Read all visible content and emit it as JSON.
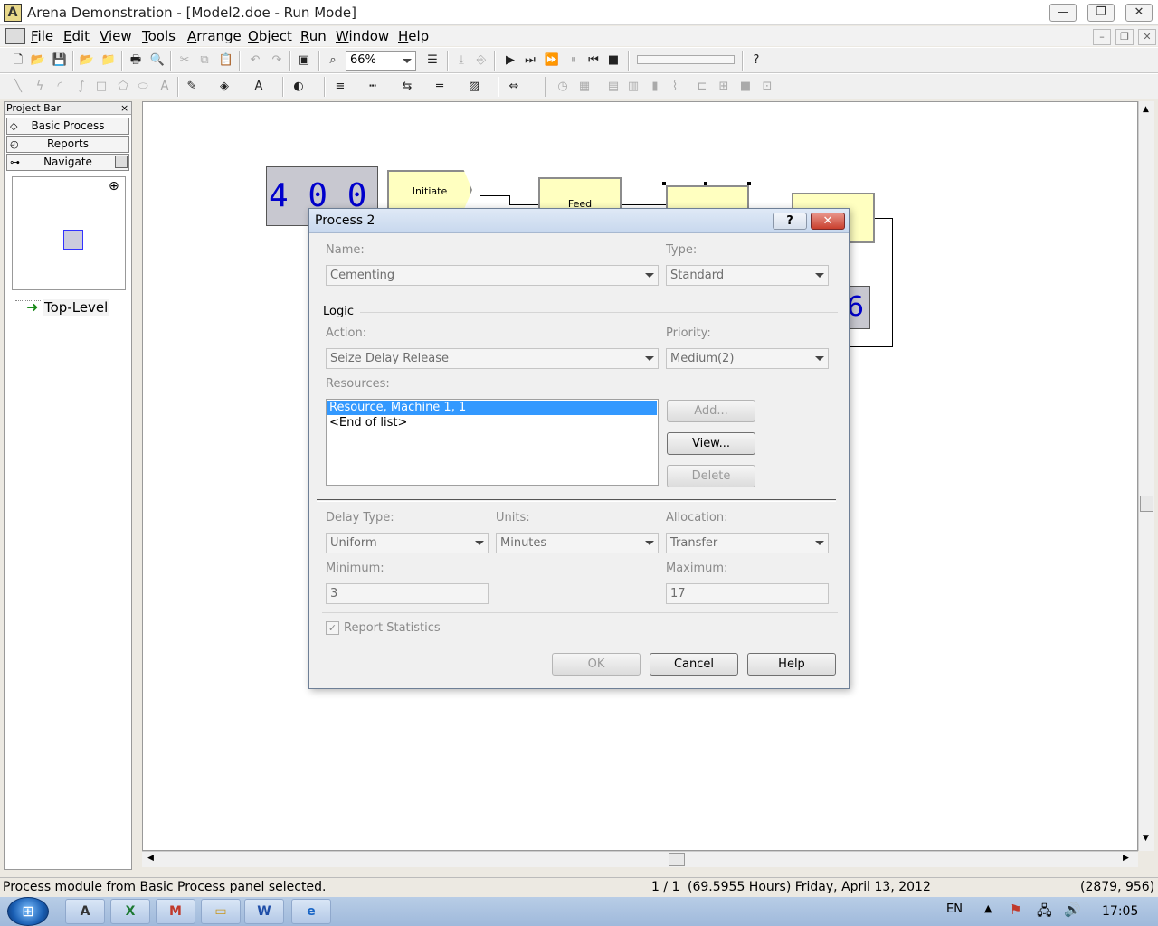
{
  "window": {
    "title": "Arena Demonstration - [Model2.doe - Run Mode]",
    "app_icon": "A"
  },
  "window_controls": {
    "minimize": "—",
    "restore": "❐",
    "close": "✕"
  },
  "menu": [
    {
      "label": "File",
      "accel": "F"
    },
    {
      "label": "Edit",
      "accel": "E"
    },
    {
      "label": "View",
      "accel": "V"
    },
    {
      "label": "Tools",
      "accel": "T"
    },
    {
      "label": "Arrange",
      "accel": "A"
    },
    {
      "label": "Object",
      "accel": "O"
    },
    {
      "label": "Run",
      "accel": "R"
    },
    {
      "label": "Window",
      "accel": "W"
    },
    {
      "label": "Help",
      "accel": "H"
    }
  ],
  "toolbar": {
    "zoom_value": "66%"
  },
  "project_bar": {
    "title": "Project Bar",
    "close": "×",
    "panels": [
      "Basic Process",
      "Reports",
      "Navigate"
    ],
    "tree_item": "Top-Level"
  },
  "canvas": {
    "counter_digits": "4 0 0   0 0",
    "counter_right": "6",
    "modules": {
      "initiate": "Initiate",
      "feed": "Feed"
    }
  },
  "dialog": {
    "title": "Process 2",
    "help_glyph": "?",
    "close_glyph": "✕",
    "name_label": "Name:",
    "name_value": "Cementing",
    "type_label": "Type:",
    "type_value": "Standard",
    "logic_label": "Logic",
    "action_label": "Action:",
    "action_value": "Seize Delay Release",
    "priority_label": "Priority:",
    "priority_value": "Medium(2)",
    "resources_label": "Resources:",
    "resources": [
      "Resource, Machine 1, 1",
      "<End of list>"
    ],
    "add_label": "Add...",
    "view_label": "View...",
    "delete_label": "Delete",
    "delay_type_label": "Delay Type:",
    "delay_type_value": "Uniform",
    "units_label": "Units:",
    "units_value": "Minutes",
    "allocation_label": "Allocation:",
    "allocation_value": "Transfer",
    "minimum_label": "Minimum:",
    "minimum_value": "3",
    "maximum_label": "Maximum:",
    "maximum_value": "17",
    "report_stats_label": "Report Statistics",
    "report_stats_checked": true,
    "ok_label": "OK",
    "cancel_label": "Cancel",
    "help_label": "Help"
  },
  "status": {
    "message": "Process module from Basic Process panel selected.",
    "page": "1 / 1",
    "sim_time": "(69.5955 Hours) Friday, April 13, 2012",
    "coords": "(2879, 956)"
  },
  "taskbar": {
    "lang": "EN",
    "time": "17:05"
  },
  "colors": {
    "selection": "#3399ff",
    "module_fill": "#ffffc0",
    "counter_fill": "#c8c8d0",
    "counter_digits": "#0000cc"
  }
}
